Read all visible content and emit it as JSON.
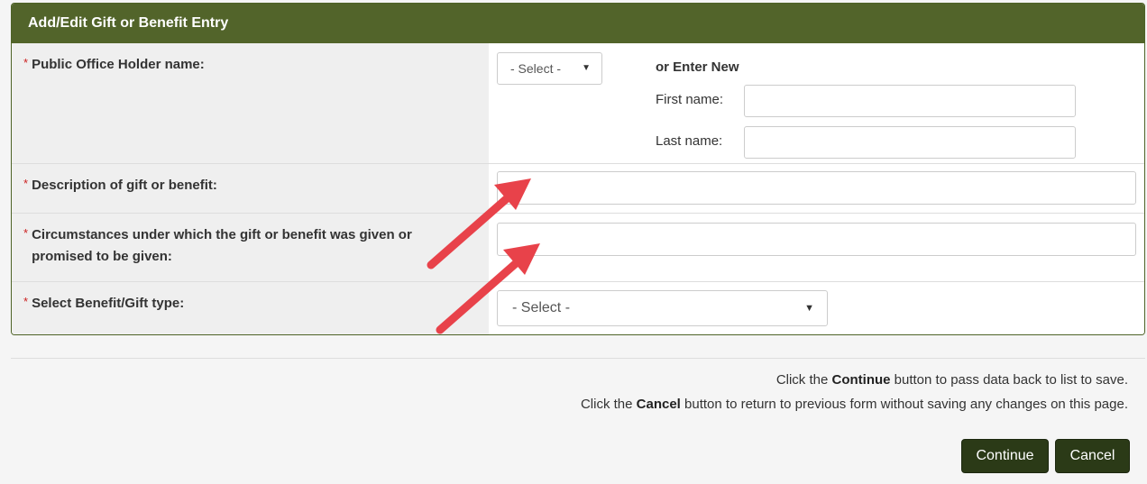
{
  "panel": {
    "title": "Add/Edit Gift or Benefit Entry"
  },
  "required_marker": "*",
  "fields": {
    "officeholder": {
      "label": "Public Office Holder name:",
      "select_value": "- Select -",
      "or_new": "or Enter New",
      "first_label": "First name:",
      "last_label": "Last name:"
    },
    "description": {
      "label": "Description of gift or benefit:"
    },
    "circumstances": {
      "label": "Circumstances under which the gift or benefit was given or promised to be given:"
    },
    "gift_type": {
      "label": "Select Benefit/Gift type:",
      "select_value": "- Select -"
    }
  },
  "instructions": {
    "continue_pre": "Click the ",
    "continue_word": "Continue",
    "continue_post": " button to pass data back to list to save.",
    "cancel_pre": "Click the ",
    "cancel_word": "Cancel",
    "cancel_post": " button to return to previous form without saving any changes on this page."
  },
  "buttons": {
    "continue": "Continue",
    "cancel": "Cancel"
  },
  "colors": {
    "header": "#52642a",
    "button": "#2b3a17",
    "arrow": "#e8424a",
    "required": "#cc1f1f"
  }
}
